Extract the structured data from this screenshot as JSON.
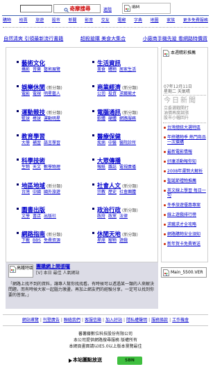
{
  "search": {
    "button_label": "奇摩搜尋",
    "advanced_label": "進階"
  },
  "top_ad": {
    "alt": "IBM"
  },
  "nav": {
    "items": [
      "購物",
      "拍賣",
      "旅遊",
      "股市",
      "新聞",
      "影音",
      "交友",
      "電郵",
      "字典",
      "地圖",
      "家族",
      "更多免費服務"
    ]
  },
  "promos": [
    "自然清爽 引領最新流行書籍",
    "超殺搶購 美食大集合",
    "小廠商手機先搶 看網路特價貨"
  ],
  "categories": {
    "left": [
      {
        "title": "藝術文化",
        "links": [
          "攝影",
          "音樂",
          "藝術展覽"
        ]
      },
      {
        "title": "娛樂休閒",
        "tag": "(新分類)",
        "links": [
          "電影",
          "電視",
          "明星藝人"
        ]
      },
      {
        "title": "運動競技",
        "tag": "(新分類)",
        "links": [
          "籃球",
          "棒球",
          "運動明星"
        ]
      },
      {
        "title": "教育學習",
        "links": [
          "大學",
          "補習",
          "語言學習"
        ]
      },
      {
        "title": "科學技術",
        "links": [
          "生物",
          "天文",
          "數學物理"
        ]
      },
      {
        "title": "地區地域",
        "tag": "(新分類)",
        "links": [
          "台灣",
          "中國",
          "國外旅遊"
        ]
      },
      {
        "title": "圖書出版",
        "links": [
          "文學",
          "書店",
          "出版社"
        ]
      },
      {
        "title": "網路指南",
        "tag": "(新分類)",
        "links": [
          "下載",
          "BBS",
          "免費資源"
        ]
      }
    ],
    "right": [
      {
        "title": "生活資訊",
        "links": [
          "美食",
          "購物",
          "居家生活"
        ]
      },
      {
        "title": "商業經濟",
        "tag": "(新分類)",
        "links": [
          "公司",
          "投資",
          "求職徵才"
        ]
      },
      {
        "title": "電腦通訊",
        "tag": "(新分類)",
        "links": [
          "軟體",
          "硬體",
          "網路服務"
        ]
      },
      {
        "title": "醫療保健",
        "links": [
          "疾病",
          "中醫",
          "醫院診所"
        ]
      },
      {
        "title": "大眾傳播",
        "links": [
          "報紙",
          "雜誌",
          "電視廣播"
        ]
      },
      {
        "title": "社會人文",
        "tag": "(新分類)",
        "links": [
          "宗教",
          "歷史",
          "社會團體"
        ]
      },
      {
        "title": "政治行政",
        "tag": "(新分類)",
        "links": [
          "政府",
          "政黨",
          "法律"
        ]
      },
      {
        "title": "休閒天地",
        "tag": "(新分類)",
        "links": [
          "星座",
          "寵物",
          "遊戲"
        ]
      }
    ]
  },
  "sidebar": {
    "feature_alt": "本週精彩推薦",
    "date_lines": [
      "07年12月11日",
      "星期二 天氣晴"
    ],
    "news_title": "今日新聞",
    "news_lines": [
      "立委選戰開打",
      "油價再度調漲",
      "股市小幅回升"
    ],
    "links": [
      "台灣總統大選特區",
      "年終購物季 熱門商品一次搶購",
      "最新電影情報",
      "好康活動報你知",
      "2008年運勢大解析",
      "聖誕節禮物推薦",
      "英文線上學習 每日一句",
      "冬季旅遊優惠專案",
      "線上遊戲排行榜",
      "求職求才全攻略",
      "網路購物安全須知",
      "新年賀卡免費寄送"
    ]
  },
  "highlight": {
    "image_alt": "高鐵特區",
    "title": "團購網上開張囉",
    "subtitle": "[V] 本日 最佳 人氣網站",
    "body": "「網路上找不到的資料，讓專人幫你找找看。有時候可以透過某一類的人來解決問題，而有時候大家一起腦力激盪，再加上網友們的經驗分享，一定可以找到你要的答案。」"
  },
  "side_ad": {
    "alt": "Main_5500.VER"
  },
  "footer": {
    "separator": "|",
    "links": [
      "網站導覽",
      "刊登廣告",
      "聯絡我們",
      "客服信箱",
      "加入好站",
      "隱私權聲明",
      "服務條款",
      "工作機會"
    ],
    "copyright": [
      "蕃薯藤數位科技股份有限公司",
      "本公司提供網路搜尋服務 版權所有",
      "本網頁畫面請以IE5.0以上版本瀏覽最佳"
    ]
  },
  "bottom": {
    "label": "本站圖點放送",
    "badge": "SBN"
  },
  "colors": {
    "link": "#0000cc",
    "rule": "#3a5fb0",
    "panel": "#dcdce6",
    "badge": "#3fbf3f",
    "button_text": "#cc0000",
    "bullet": "#cc2200"
  }
}
